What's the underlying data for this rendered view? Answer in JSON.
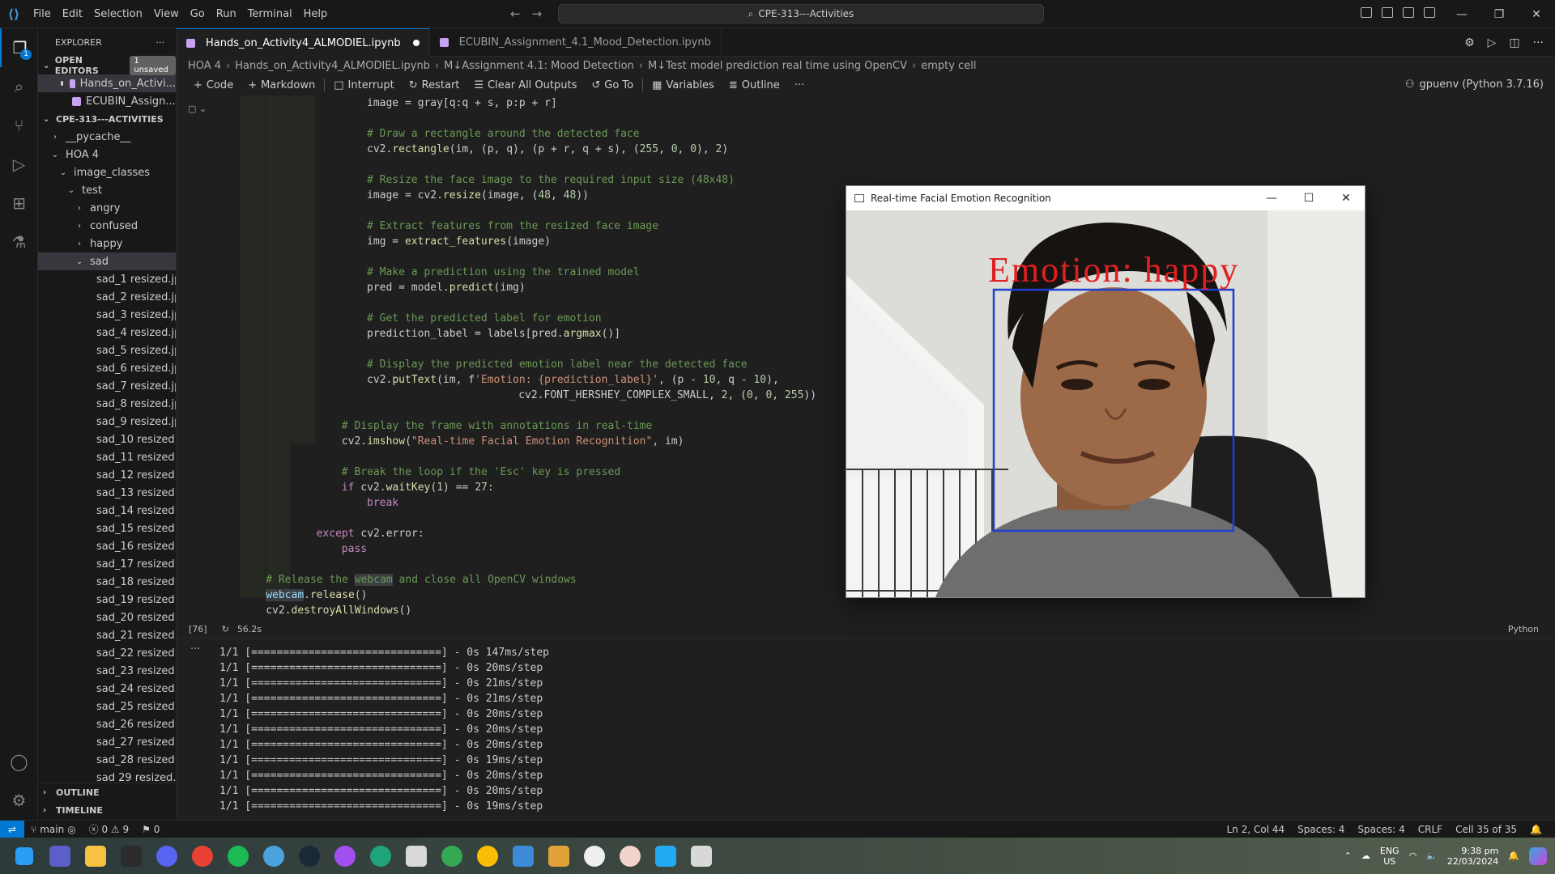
{
  "titlebar": {
    "menu": [
      "File",
      "Edit",
      "Selection",
      "View",
      "Go",
      "Run",
      "Terminal",
      "Help"
    ],
    "command_center": "CPE-313---Activities"
  },
  "sidebar": {
    "title": "EXPLORER",
    "open_editors_label": "OPEN EDITORS",
    "unsaved_badge": "1 unsaved",
    "open_editors": [
      "Hands_on_Activi...",
      "ECUBIN_Assign..."
    ],
    "workspace_label": "CPE-313---ACTIVITIES",
    "tree": {
      "pycache": "__pycache__",
      "hoa4": "HOA 4",
      "image_classes": "image_classes",
      "test": "test",
      "angry": "angry",
      "confused": "confused",
      "happy": "happy",
      "sad": "sad"
    },
    "files": [
      "sad_1 resized.jpg",
      "sad_2 resized.jpg",
      "sad_3 resized.jpg",
      "sad_4 resized.jpg",
      "sad_5 resized.jpg",
      "sad_6 resized.jpg",
      "sad_7 resized.jpg",
      "sad_8 resized.jpg",
      "sad_9 resized.jpg",
      "sad_10 resized.j...",
      "sad_11 resized.j...",
      "sad_12 resized.j...",
      "sad_13 resized.j...",
      "sad_14 resized.j...",
      "sad_15 resized.j...",
      "sad_16 resized.j...",
      "sad_17 resized.j...",
      "sad_18 resized.j...",
      "sad_19 resized.j...",
      "sad_20 resized.j...",
      "sad_21 resized.j...",
      "sad_22 resized.j...",
      "sad_23 resized.j...",
      "sad_24 resized.j...",
      "sad_25 resized.j...",
      "sad_26 resized.j...",
      "sad_27 resized.j...",
      "sad_28 resized.j...",
      "sad 29 resized.i..."
    ],
    "outline_label": "OUTLINE",
    "timeline_label": "TIMELINE"
  },
  "tabs": [
    {
      "label": "Hands_on_Activity4_ALMODIEL.ipynb",
      "active": true,
      "modified": true
    },
    {
      "label": "ECUBIN_Assignment_4.1_Mood_Detection.ipynb",
      "active": false,
      "modified": false
    }
  ],
  "breadcrumb": [
    "HOA 4",
    "Hands_on_Activity4_ALMODIEL.ipynb",
    "M↓Assignment 4.1: Mood Detection",
    "M↓Test model prediction real time using OpenCV",
    "empty cell"
  ],
  "nb_toolbar": {
    "code": "Code",
    "markdown": "Markdown",
    "interrupt": "Interrupt",
    "restart": "Restart",
    "clear": "Clear All Outputs",
    "goto": "Go To",
    "variables": "Variables",
    "outline": "Outline",
    "kernel": "gpuenv (Python 3.7.16)"
  },
  "cell": {
    "exec_count": "[76]",
    "duration": "56.2s",
    "language": "Python"
  },
  "code_lines": [
    "image = gray[q:q + s, p:p + r]",
    "",
    "# Draw a rectangle around the detected face",
    "cv2.rectangle(im, (p, q), (p + r, q + s), (255, 0, 0), 2)",
    "",
    "# Resize the face image to the required input size (48x48)",
    "image = cv2.resize(image, (48, 48))",
    "",
    "# Extract features from the resized face image",
    "img = extract_features(image)",
    "",
    "# Make a prediction using the trained model",
    "pred = model.predict(img)",
    "",
    "# Get the predicted label for emotion",
    "prediction_label = labels[pred.argmax()]",
    "",
    "# Display the predicted emotion label near the detected face",
    "cv2.putText(im, f'Emotion: {prediction_label}', (p - 10, q - 10),",
    "cv2.FONT_HERSHEY_COMPLEX_SMALL, 2, (0, 0, 255))",
    "",
    "# Display the frame with annotations in real-time",
    "cv2.imshow(\"Real-time Facial Emotion Recognition\", im)",
    "",
    "# Break the loop if the 'Esc' key is pressed",
    "if cv2.waitKey(1) == 27:",
    "break",
    "",
    "except cv2.error:",
    "pass",
    "",
    "# Release the webcam and close all OpenCV windows",
    "webcam.release()",
    "cv2.destroyAllWindows()"
  ],
  "output_lines": [
    "1/1 [==============================] - 0s 147ms/step",
    "1/1 [==============================] - 0s 20ms/step",
    "1/1 [==============================] - 0s 21ms/step",
    "1/1 [==============================] - 0s 21ms/step",
    "1/1 [==============================] - 0s 20ms/step",
    "1/1 [==============================] - 0s 20ms/step",
    "1/1 [==============================] - 0s 20ms/step",
    "1/1 [==============================] - 0s 19ms/step",
    "1/1 [==============================] - 0s 20ms/step",
    "1/1 [==============================] - 0s 20ms/step",
    "1/1 [==============================] - 0s 19ms/step"
  ],
  "cv_window": {
    "title": "Real-time Facial Emotion Recognition",
    "overlay_text": "Emotion: happy",
    "overlay_color": "#e02020",
    "box_color": "#1f3fd0"
  },
  "statusbar": {
    "branch": "main",
    "problems": "ⓧ 0 ⚠ 9",
    "ports": "⚑ 0",
    "position": "Ln 2, Col 44",
    "spaces1": "Spaces: 4",
    "spaces2": "Spaces: 4",
    "eol": "CRLF",
    "cell": "Cell 35 of 35"
  },
  "tray": {
    "lang1": "ENG",
    "lang2": "US",
    "time": "9:38 pm",
    "date": "22/03/2024"
  },
  "colors": {
    "accent": "#0078d4",
    "editor_bg": "#1f1f1f",
    "comment": "#6a9955"
  }
}
